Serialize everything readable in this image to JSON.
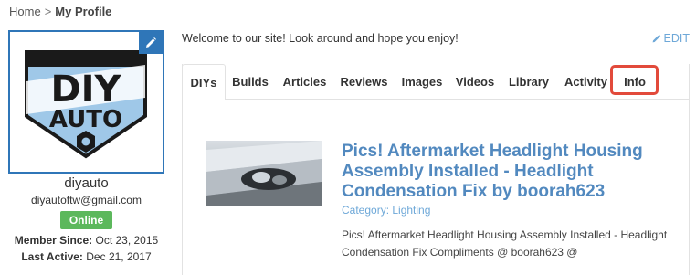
{
  "breadcrumb": {
    "home": "Home",
    "separator": ">",
    "current": "My Profile"
  },
  "profile": {
    "username": "diyauto",
    "email": "diyautoftw@gmail.com",
    "status": "Online",
    "member_since_label": "Member Since:",
    "member_since": "Oct 23, 2015",
    "last_active_label": "Last Active:",
    "last_active": "Dec 21, 2017",
    "logo_line1": "DIY",
    "logo_line2": "AUTO"
  },
  "welcome_message": "Welcome to our site! Look around and hope you enjoy!",
  "edit_label": "EDIT",
  "tabs": [
    {
      "label": "DIYs"
    },
    {
      "label": "Builds"
    },
    {
      "label": "Articles"
    },
    {
      "label": "Reviews"
    },
    {
      "label": "Images"
    },
    {
      "label": "Videos"
    },
    {
      "label": "Library"
    },
    {
      "label": "Activity"
    },
    {
      "label": "Info"
    }
  ],
  "post": {
    "title": "Pics! Aftermarket Headlight Housing Assembly Installed - Headlight Condensation Fix by boorah623",
    "category": "Category: Lighting",
    "excerpt": "Pics! Aftermarket Headlight Housing Assembly Installed - Headlight Condensation Fix Compliments @ boorah623 @"
  },
  "colors": {
    "brand_blue": "#2f76b8",
    "link_blue": "#5289bf",
    "online_green": "#5cb85c",
    "highlight_red": "#e24a3b"
  }
}
